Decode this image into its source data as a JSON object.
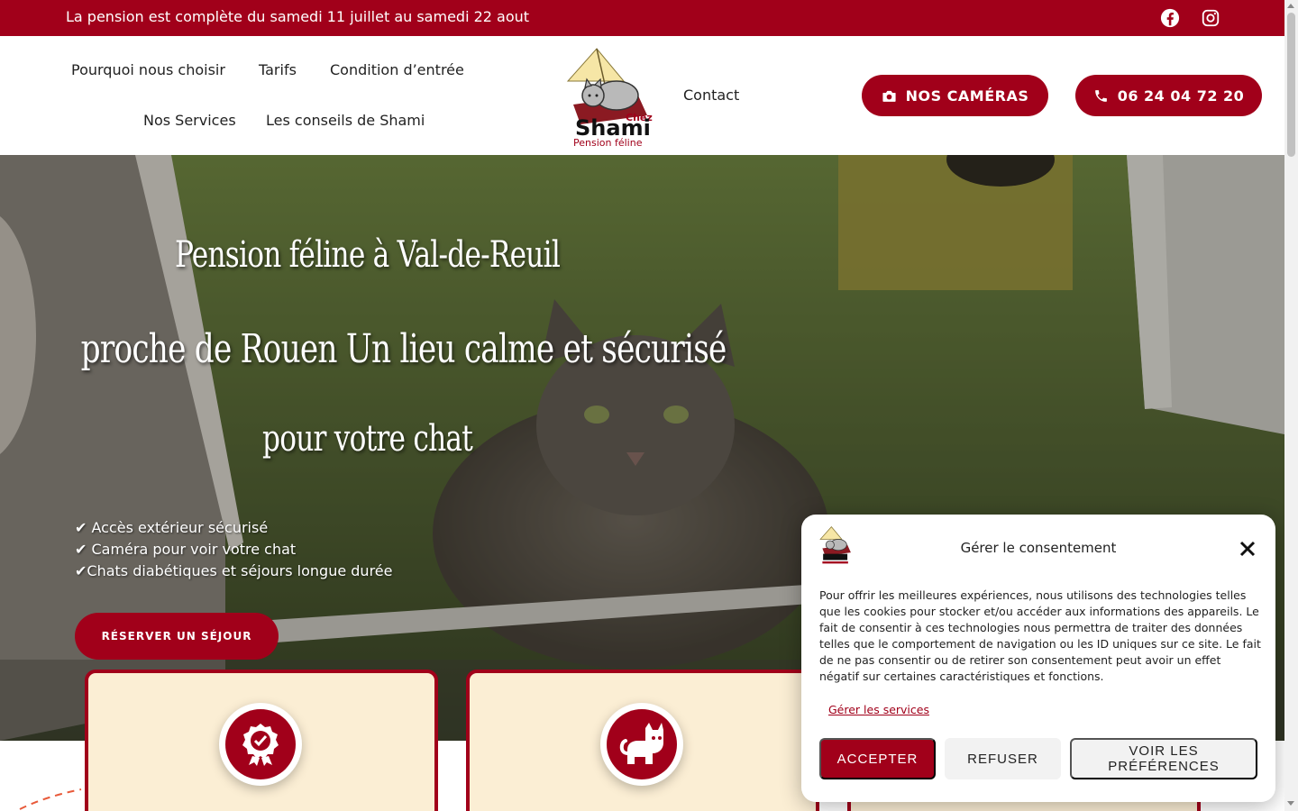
{
  "topbar": {
    "message": "La pension est complète du samedi 11 juillet au samedi 22 aout",
    "social": [
      "facebook-icon",
      "instagram-icon"
    ]
  },
  "nav": {
    "items": [
      "Pourquoi nous choisir",
      "Tarifs",
      "Condition d’entrée",
      "Nos Services",
      "Les conseils de Shami",
      "Contact"
    ],
    "logo_alt": "Chez Shami Pension féline",
    "cameras_label": "NOS CAMÉRAS",
    "phone_label": "06 24 04 72 20"
  },
  "hero": {
    "title_lines": [
      "Pension féline à Val-de-Reuil",
      "proche de Rouen Un lieu calme et sécurisé",
      "pour votre chat"
    ],
    "bullets": [
      "✔ Accès extérieur sécurisé",
      "✔ Caméra pour voir votre chat",
      "✔Chats diabétiques et séjours longue durée"
    ],
    "cta": "RÉSERVER UN SÉJOUR"
  },
  "cards": [
    {
      "icon": "award-badge-icon"
    },
    {
      "icon": "cat-icon"
    },
    {
      "icon": "unknown"
    }
  ],
  "consent": {
    "title": "Gérer le consentement",
    "text": "Pour offrir les meilleures expériences, nous utilisons des technologies telles que les cookies pour stocker et/ou accéder aux informations des appareils. Le fait de consentir à ces technologies nous permettra de traiter des données telles que le comportement de navigation ou les ID uniques sur ce site. Le fait de ne pas consentir ou de retirer son consentement peut avoir un effet négatif sur certaines caractéristiques et fonctions.",
    "manage_link": "Gérer les services",
    "accept": "ACCEPTER",
    "refuse": "REFUSER",
    "prefs": "VOIR LES PRÉFÉRENCES"
  },
  "colors": {
    "brand": "#a1001a",
    "card_bg": "#fbeed4"
  }
}
